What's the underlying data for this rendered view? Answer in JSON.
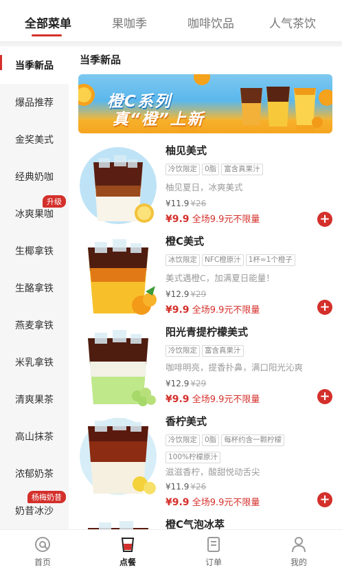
{
  "top_tabs": [
    "全部菜单",
    "果咖季",
    "咖啡饮品",
    "人气茶饮"
  ],
  "sidebar": {
    "items": [
      {
        "label": "当季新品",
        "badge": ""
      },
      {
        "label": "爆品推荐",
        "badge": ""
      },
      {
        "label": "金奖美式",
        "badge": ""
      },
      {
        "label": "经典奶咖",
        "badge": ""
      },
      {
        "label": "冰爽果咖",
        "badge": "升级"
      },
      {
        "label": "生椰拿铁",
        "badge": ""
      },
      {
        "label": "生酪拿铁",
        "badge": ""
      },
      {
        "label": "燕麦拿铁",
        "badge": ""
      },
      {
        "label": "米乳拿铁",
        "badge": ""
      },
      {
        "label": "清爽果茶",
        "badge": ""
      },
      {
        "label": "高山抹茶",
        "badge": ""
      },
      {
        "label": "浓郁奶茶",
        "badge": ""
      },
      {
        "label": "奶昔冰沙",
        "badge": "杨梅奶昔"
      }
    ]
  },
  "section_title": "当季新品",
  "banner": {
    "title": "橙C系列",
    "subtitle": "真“橙”上新"
  },
  "products": [
    {
      "name": "柚见美式",
      "tags": [
        "冷饮限定",
        "0脂",
        "富含真果汁"
      ],
      "desc": "柚见夏日，冰爽美式",
      "price": "¥11.9",
      "orig_price": "¥26",
      "promo_price": "¥9.9",
      "promo_text": "全场9.9元不限量"
    },
    {
      "name": "橙C美式",
      "tags": [
        "冰饮限定",
        "NFC橙原汁",
        "1杯≈1个橙子"
      ],
      "desc": "美式遇橙C，加满夏日能量！",
      "price": "¥12.9",
      "orig_price": "¥29",
      "promo_price": "¥9.9",
      "promo_text": "全场9.9元不限量"
    },
    {
      "name": "阳光青提柠檬美式",
      "tags": [
        "冷饮限定",
        "富含真果汁"
      ],
      "desc": "咖啡明亮，提香扑鼻，满口阳光沁爽",
      "price": "¥12.9",
      "orig_price": "¥29",
      "promo_price": "¥9.9",
      "promo_text": "全场9.9元不限量"
    },
    {
      "name": "香柠美式",
      "tags": [
        "冷饮限定",
        "0脂",
        "每杯约含一颗柠檬",
        "100%柠檬原汁"
      ],
      "desc": "滋滋香柠，酸甜悦动舌尖",
      "price": "¥11.9",
      "orig_price": "¥26",
      "promo_price": "¥9.9",
      "promo_text": "全场9.9元不限量"
    },
    {
      "name": "橙C气泡冰萃",
      "tags": [],
      "desc": "",
      "price": "",
      "orig_price": "",
      "promo_price": "",
      "promo_text": ""
    }
  ],
  "bottom_nav": [
    "首页",
    "点餐",
    "订单",
    "我的"
  ],
  "colors": {
    "accent": "#d4302b"
  }
}
